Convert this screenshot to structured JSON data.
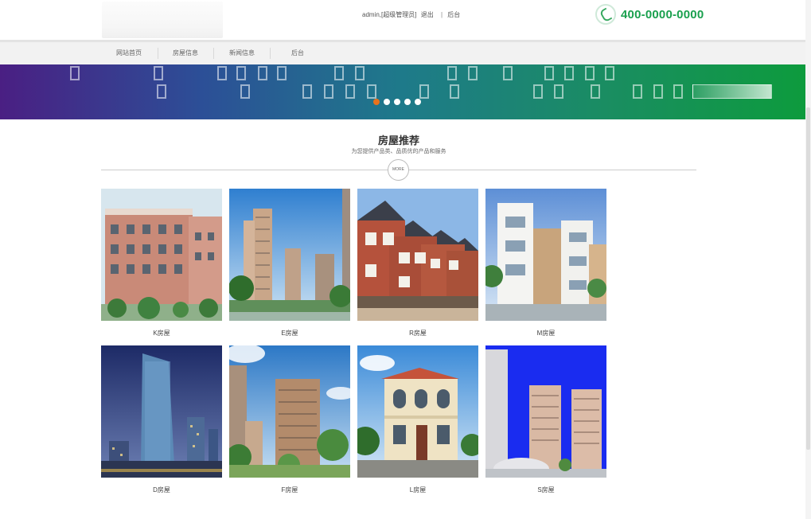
{
  "header": {
    "user_text": "admin,[超级管理员]",
    "logout": "退出",
    "separator": "|",
    "admin_link": "后台",
    "phone": "400-0000-0000",
    "phone_icon": "phone-icon"
  },
  "nav": {
    "items": [
      {
        "label": "网站首页"
      },
      {
        "label": "房屋信息"
      },
      {
        "label": "新闻信息"
      },
      {
        "label": "后台"
      }
    ]
  },
  "banner": {
    "slide_count": 5,
    "active_slide": 1,
    "active_color": "#e8721c"
  },
  "section": {
    "title": "房屋推荐",
    "subtitle": "为您提供产品类、品质优的产品和服务",
    "more_label": "MORE"
  },
  "houses": [
    {
      "name": "K房屋"
    },
    {
      "name": "E房屋"
    },
    {
      "name": "R房屋"
    },
    {
      "name": "M房屋"
    },
    {
      "name": "D房屋"
    },
    {
      "name": "F房屋"
    },
    {
      "name": "L房屋"
    },
    {
      "name": "S房屋"
    }
  ],
  "colors": {
    "brand_green": "#1aa04e",
    "banner_start": "#4a1f83",
    "banner_end": "#0d9b3d"
  }
}
